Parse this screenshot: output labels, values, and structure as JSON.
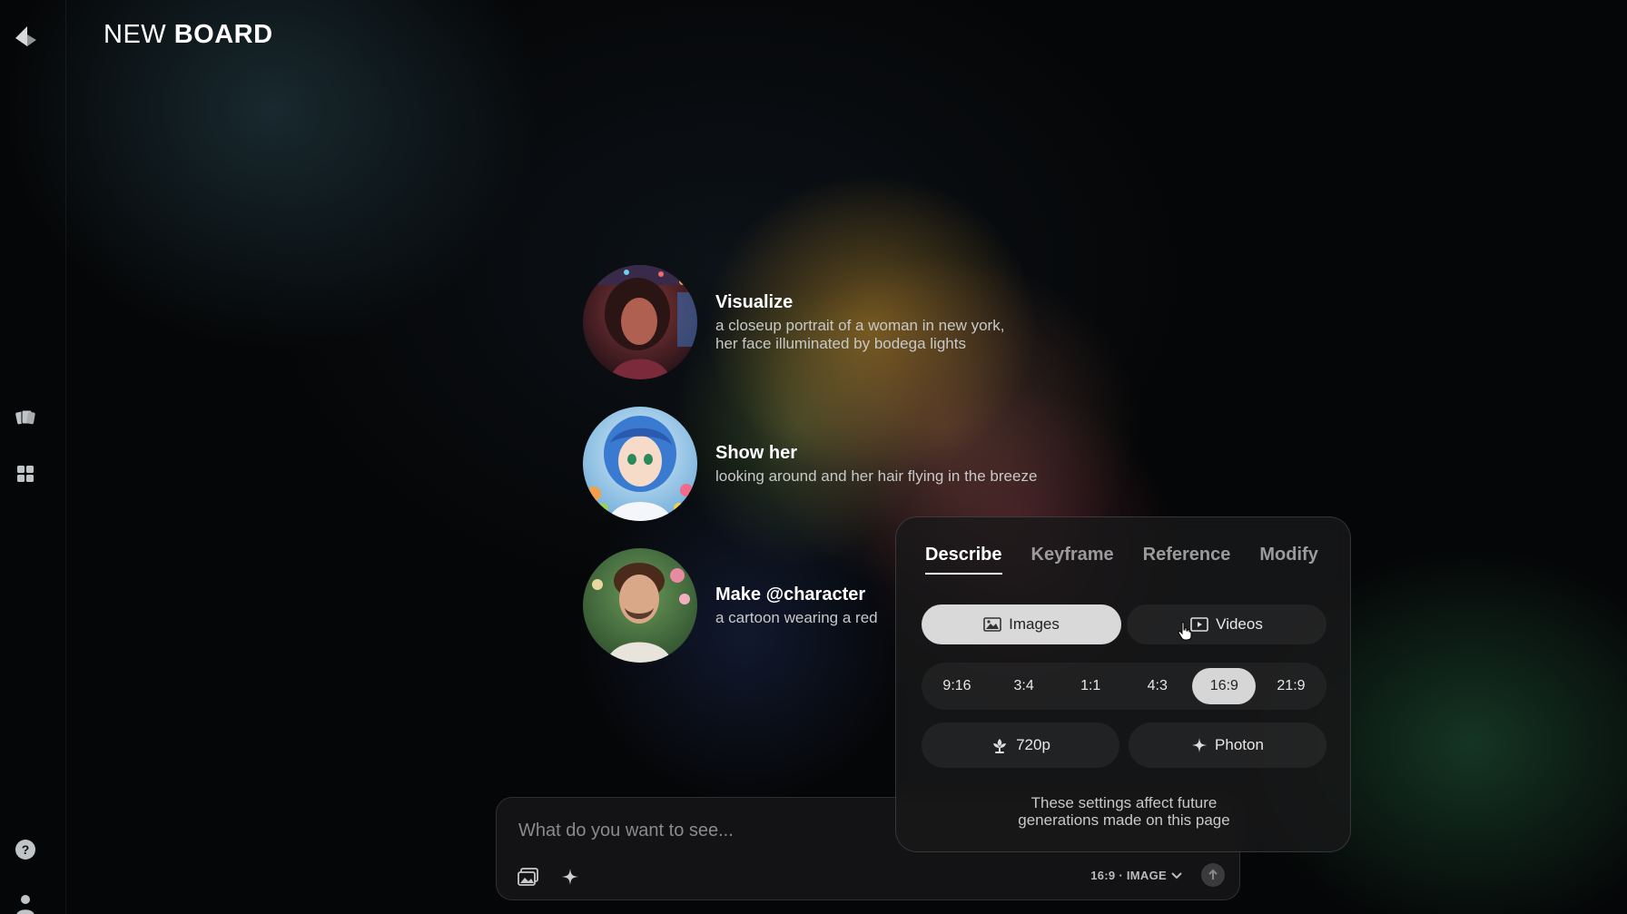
{
  "header": {
    "title_light": "NEW ",
    "title_bold": "BOARD"
  },
  "sidebar": {
    "icons": [
      "logo-icon",
      "cards-icon",
      "grid-icon",
      "help-icon",
      "user-icon"
    ]
  },
  "suggestions": [
    {
      "title": "Visualize",
      "subtitle": "a closeup portrait of a woman in new york,\nher face illuminated by bodega lights"
    },
    {
      "title": "Show her",
      "subtitle": "looking around and her hair flying in the breeze"
    },
    {
      "title": "Make @character",
      "subtitle": "a cartoon wearing a red"
    }
  ],
  "prompt": {
    "placeholder": "What do you want to see...",
    "mode_label": "16:9 · IMAGE"
  },
  "settings": {
    "tabs": [
      {
        "label": "Describe",
        "active": true
      },
      {
        "label": "Keyframe",
        "active": false
      },
      {
        "label": "Reference",
        "active": false
      },
      {
        "label": "Modify",
        "active": false
      }
    ],
    "type_options": [
      {
        "label": "Images",
        "active": true
      },
      {
        "label": "Videos",
        "active": false
      }
    ],
    "ratios": [
      {
        "label": "9:16",
        "active": false
      },
      {
        "label": "3:4",
        "active": false
      },
      {
        "label": "1:1",
        "active": false
      },
      {
        "label": "4:3",
        "active": false
      },
      {
        "label": "16:9",
        "active": true
      },
      {
        "label": "21:9",
        "active": false
      }
    ],
    "resolution_label": "720p",
    "model_label": "Photon",
    "note": "These settings affect future\ngenerations made on this page"
  },
  "colors": {
    "active_pill": "#d9d9d9",
    "panel_bg": "#18181a",
    "text_primary": "#ffffff",
    "text_muted": "#9b9b9b"
  }
}
